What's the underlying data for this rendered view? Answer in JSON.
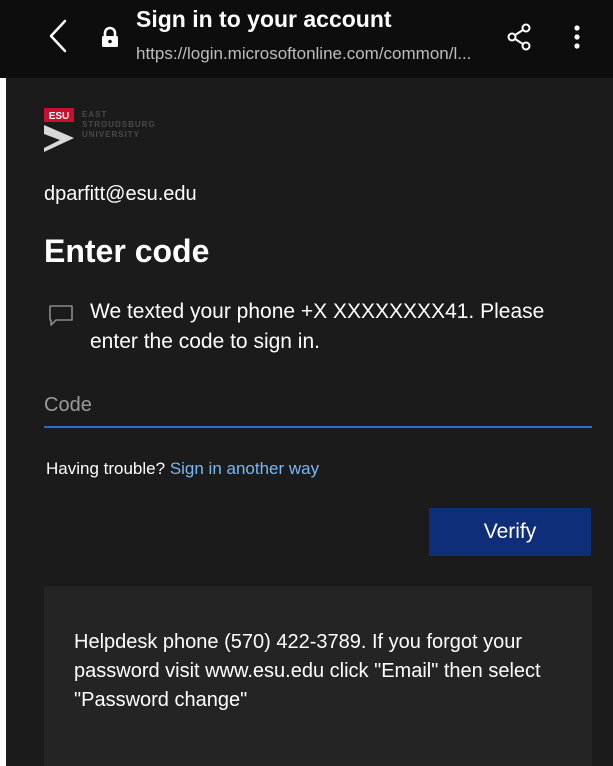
{
  "browser": {
    "title": "Sign in to your account",
    "url": "https://login.microsoftonline.com/common/l..."
  },
  "logo": {
    "badge": "ESU",
    "line1": "EAST",
    "line2": "STROUDSBURG",
    "line3": "UNIVERSITY"
  },
  "signin": {
    "account": "dparfitt@esu.edu",
    "heading": "Enter code",
    "message": "We texted your phone +X XXXXXXXX41. Please enter the code to sign in.",
    "code_placeholder": "Code",
    "code_value": "",
    "trouble_text": "Having trouble?",
    "trouble_link": "Sign in another way",
    "verify_label": "Verify"
  },
  "helpdesk": {
    "text": "Helpdesk phone (570) 422-3789. If you forgot your password visit www.esu.edu click \"Email\" then select \"Password change\""
  },
  "icons": {
    "back": "chevron-left-icon",
    "lock": "lock-icon",
    "share": "share-icon",
    "menu": "more-vertical-icon",
    "message": "message-icon"
  },
  "colors": {
    "topbar": "#0d0d0d",
    "page_background": "#1b1b1b",
    "accent": "#2a6cc4",
    "link": "#79b8f2",
    "button": "#0e2e7a",
    "help_box": "#242424",
    "logo_red": "#c8102e"
  }
}
